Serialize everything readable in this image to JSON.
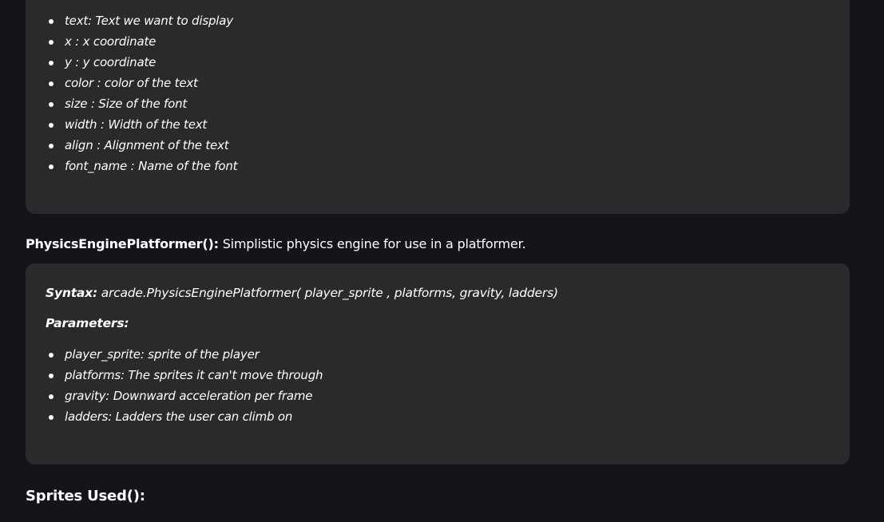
{
  "text_params": [
    "text: Text we want to display",
    "x : x coordinate",
    "y : y coordinate",
    "color : color of the text",
    "size : Size of the font",
    "width : Width of the text",
    "align : Alignment of the text",
    "font_name : Name of the font"
  ],
  "physics": {
    "name": "PhysicsEnginePlatformer():",
    "description": " Simplistic physics engine for use in a platformer.",
    "syntax_label": "Syntax:",
    "syntax_code": " arcade.PhysicsEnginePlatformer( player_sprite , platforms, gravity, ladders)",
    "parameters_label": "Parameters:",
    "params": [
      "player_sprite: sprite of the player",
      "platforms: The sprites it can't move through",
      "gravity: Downward acceleration per frame",
      "ladders: Ladders the user can climb on"
    ]
  },
  "sprites_heading": "Sprites Used():",
  "colors": {
    "background": "#141518",
    "card": "#2a2a2d",
    "text": "#ffffff"
  }
}
